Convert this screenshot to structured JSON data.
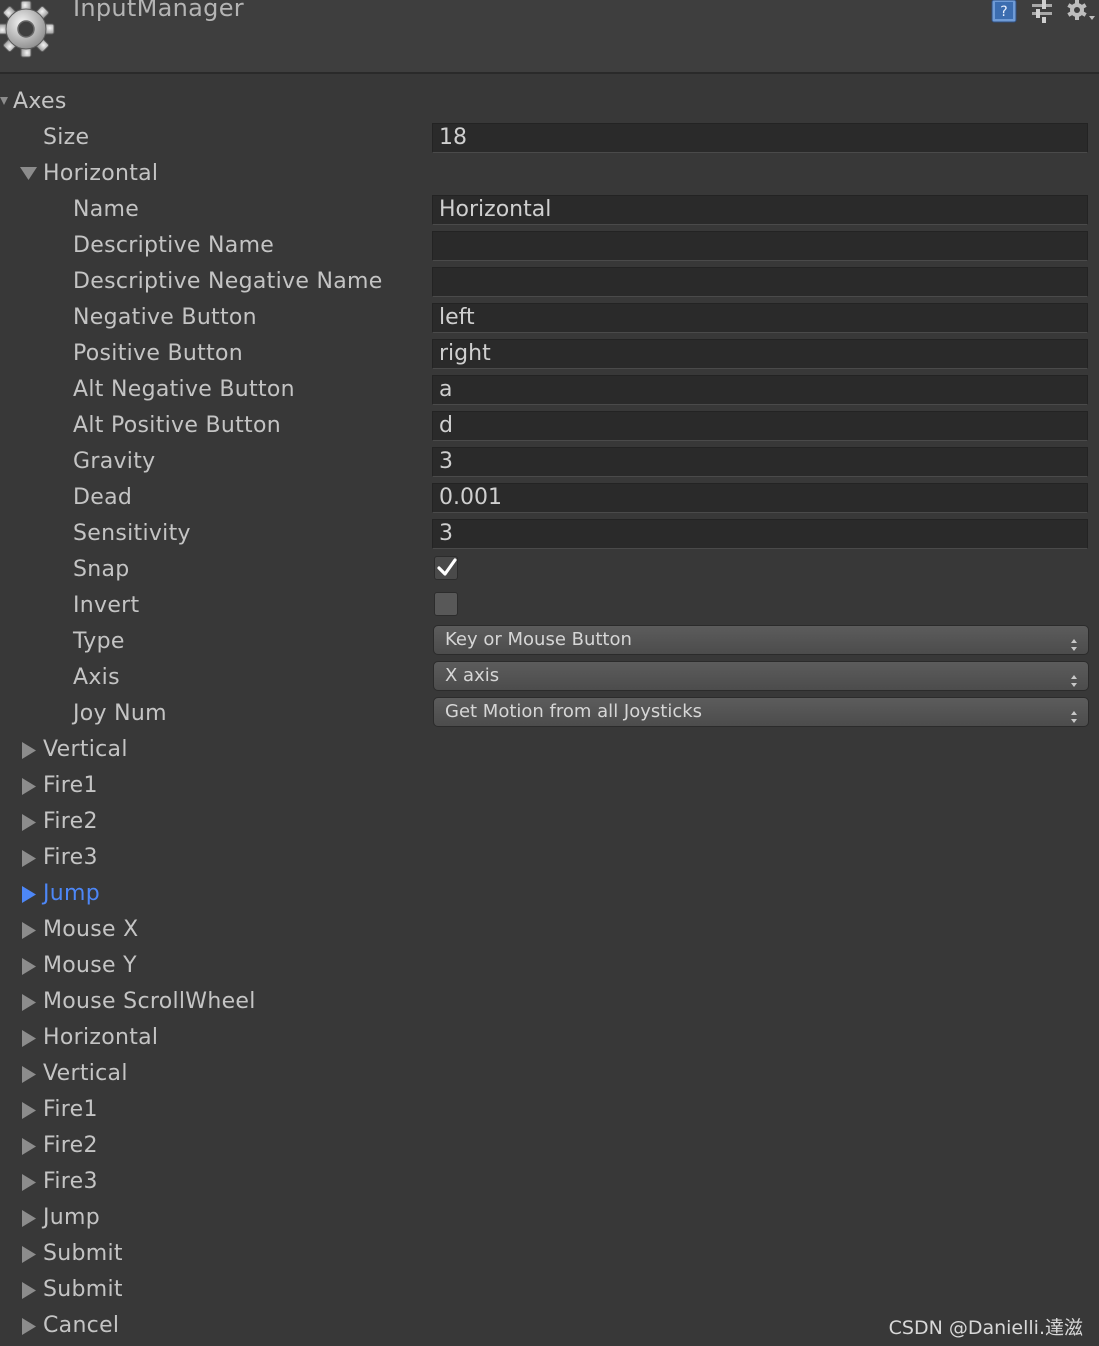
{
  "header": {
    "title": "InputManager",
    "icons": [
      "gear-logo-icon",
      "help-book-icon",
      "preset-sliders-icon",
      "settings-gear-icon"
    ]
  },
  "axes": {
    "label": "Axes",
    "size_label": "Size",
    "size_value": "18"
  },
  "expanded": {
    "label": "Horizontal",
    "fields": [
      {
        "label": "Name",
        "kind": "text",
        "value": "Horizontal"
      },
      {
        "label": "Descriptive Name",
        "kind": "text",
        "value": ""
      },
      {
        "label": "Descriptive Negative Name",
        "kind": "text",
        "value": ""
      },
      {
        "label": "Negative Button",
        "kind": "text",
        "value": "left"
      },
      {
        "label": "Positive Button",
        "kind": "text",
        "value": "right"
      },
      {
        "label": "Alt Negative Button",
        "kind": "text",
        "value": "a"
      },
      {
        "label": "Alt Positive Button",
        "kind": "text",
        "value": "d"
      },
      {
        "label": "Gravity",
        "kind": "text",
        "value": "3"
      },
      {
        "label": "Dead",
        "kind": "text",
        "value": "0.001"
      },
      {
        "label": "Sensitivity",
        "kind": "text",
        "value": "3"
      },
      {
        "label": "Snap",
        "kind": "checkbox",
        "checked": true
      },
      {
        "label": "Invert",
        "kind": "checkbox",
        "checked": false
      },
      {
        "label": "Type",
        "kind": "dropdown",
        "value": "Key or Mouse Button"
      },
      {
        "label": "Axis",
        "kind": "dropdown",
        "value": "X axis"
      },
      {
        "label": "Joy Num",
        "kind": "dropdown",
        "value": "Get Motion from all Joysticks"
      }
    ]
  },
  "collapsed_items": [
    {
      "label": "Vertical",
      "highlight": false
    },
    {
      "label": "Fire1",
      "highlight": false
    },
    {
      "label": "Fire2",
      "highlight": false
    },
    {
      "label": "Fire3",
      "highlight": false
    },
    {
      "label": "Jump",
      "highlight": true
    },
    {
      "label": "Mouse X",
      "highlight": false
    },
    {
      "label": "Mouse Y",
      "highlight": false
    },
    {
      "label": "Mouse ScrollWheel",
      "highlight": false
    },
    {
      "label": "Horizontal",
      "highlight": false
    },
    {
      "label": "Vertical",
      "highlight": false
    },
    {
      "label": "Fire1",
      "highlight": false
    },
    {
      "label": "Fire2",
      "highlight": false
    },
    {
      "label": "Fire3",
      "highlight": false
    },
    {
      "label": "Jump",
      "highlight": false
    },
    {
      "label": "Submit",
      "highlight": false
    },
    {
      "label": "Submit",
      "highlight": false
    },
    {
      "label": "Cancel",
      "highlight": false
    }
  ],
  "colors": {
    "background": "#383838",
    "text": "#c4c4c4",
    "highlight": "#4d87f7",
    "field_bg": "#2a2a2a"
  },
  "watermark": "CSDN @Danielli.達滋"
}
